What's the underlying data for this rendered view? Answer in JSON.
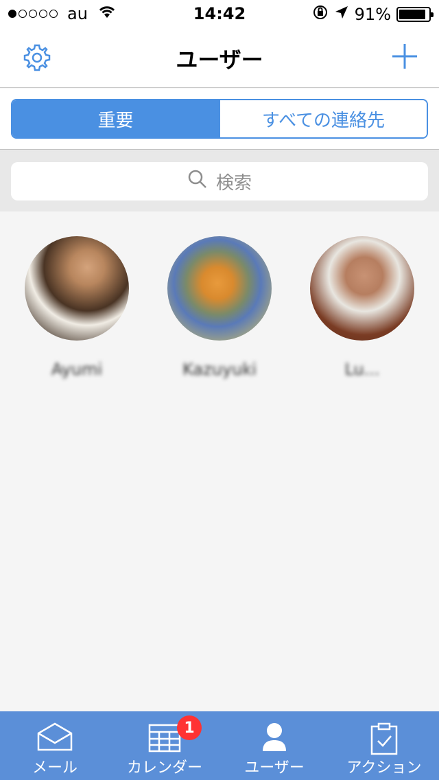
{
  "status_bar": {
    "carrier": "au",
    "time": "14:42",
    "battery_percent": "91%",
    "battery_level": 0.91,
    "signal_strength": 1,
    "signal_total": 5
  },
  "nav": {
    "title": "ユーザー",
    "settings_icon": "gear-icon",
    "add_icon": "plus-icon"
  },
  "segments": {
    "important": "重要",
    "all_contacts": "すべての連絡先",
    "selected": "important"
  },
  "search": {
    "placeholder": "検索"
  },
  "contacts": [
    {
      "name": "Ayumi"
    },
    {
      "name": "Kazuyuki"
    },
    {
      "name": "Lu..."
    }
  ],
  "tabs": [
    {
      "label": "メール",
      "icon": "mail-icon"
    },
    {
      "label": "カレンダー",
      "icon": "calendar-icon",
      "badge": "1"
    },
    {
      "label": "ユーザー",
      "icon": "user-icon"
    },
    {
      "label": "アクション",
      "icon": "clipboard-check-icon"
    }
  ],
  "colors": {
    "accent": "#4a90e2",
    "tab_bar": "#5b8fd8",
    "badge": "#ff3333"
  }
}
